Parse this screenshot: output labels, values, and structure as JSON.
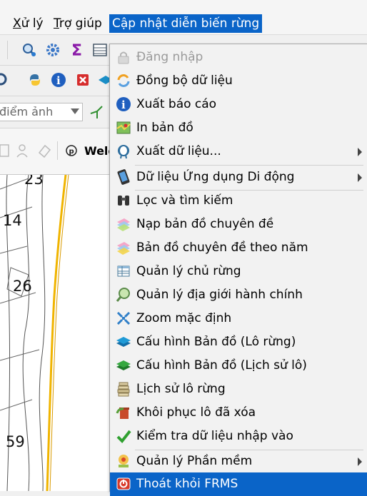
{
  "menubar": {
    "items": [
      {
        "label": "Xử lý",
        "hotkey": "X",
        "rest": "ử lý"
      },
      {
        "label": "Trợ giúp",
        "hotkey": "T",
        "rest": "rợ giúp"
      },
      {
        "label": "Cập nhật diễn biến rừng"
      }
    ]
  },
  "toolbar": {
    "combo_value": "điểm ảnh",
    "welcome_text": "Welc"
  },
  "map": {
    "labels": [
      "23",
      "14",
      "26",
      "59"
    ]
  },
  "dropdown": {
    "items": [
      {
        "label": "Đăng nhập",
        "icon": "lock-icon",
        "enabled": false
      },
      {
        "label": "Đồng bộ dữ liệu",
        "icon": "sync-icon"
      },
      {
        "label": "Xuất báo cáo",
        "icon": "info-icon"
      },
      {
        "label": "In bản đồ",
        "icon": "print-map-icon"
      },
      {
        "label": "Xuất dữ liệu...",
        "icon": "postgres-elephant-icon",
        "submenu": true
      },
      {
        "label": "Dữ liệu Ứng dụng Di động",
        "icon": "mobile-device-icon",
        "submenu": true
      },
      {
        "label": "Lọc và tìm kiếm",
        "icon": "binoculars-icon"
      },
      {
        "label": "Nạp bản đồ chuyên đề",
        "icon": "thematic-map-icon"
      },
      {
        "label": "Bản đồ chuyên đề theo năm",
        "icon": "thematic-map-year-icon"
      },
      {
        "label": "Quản lý chủ rừng",
        "icon": "table-icon"
      },
      {
        "label": "Quản lý địa giới hành chính",
        "icon": "zoom-map-icon"
      },
      {
        "label": "Zoom mặc định",
        "icon": "zoom-extent-icon"
      },
      {
        "label": "Cấu hình Bản đồ (Lô rừng)",
        "icon": "blue-layers-icon"
      },
      {
        "label": "Cấu hình Bản đồ (Lịch sử lô)",
        "icon": "green-layers-icon"
      },
      {
        "label": "Lịch sử lô rừng",
        "icon": "stack-icon"
      },
      {
        "label": "Khôi phục lô đã xóa",
        "icon": "restore-icon"
      },
      {
        "label": "Kiểm tra dữ liệu nhập vào",
        "icon": "checkmark-icon"
      },
      {
        "label": "Quản lý Phần mềm",
        "icon": "software-icon",
        "submenu": true
      },
      {
        "label": "Thoát khỏi FRMS",
        "icon": "exit-icon",
        "selected": true
      }
    ]
  },
  "colors": {
    "accent": "#0a64c8",
    "road": "#f0b400"
  }
}
